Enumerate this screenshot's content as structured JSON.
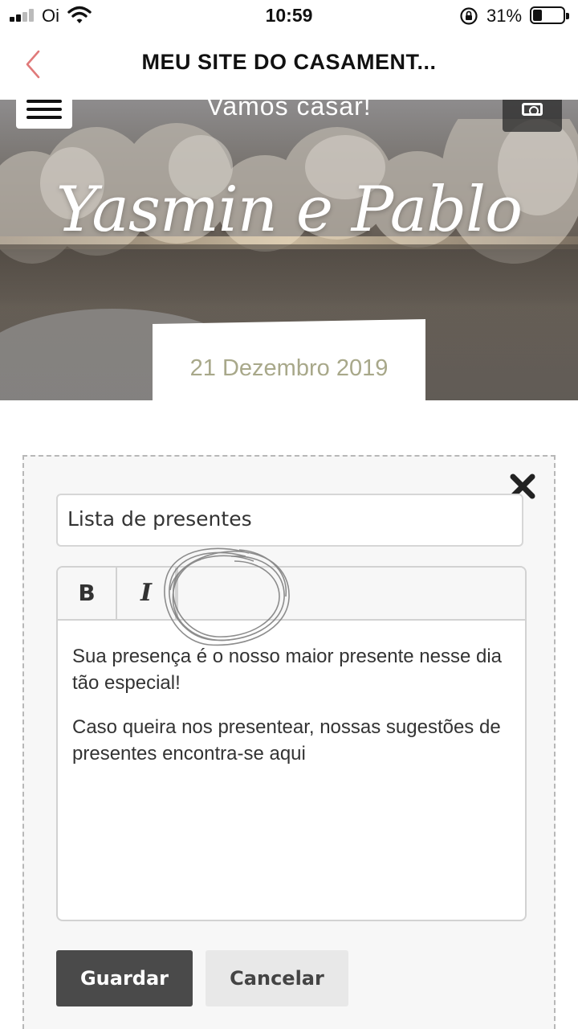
{
  "status_bar": {
    "carrier": "Oi",
    "time": "10:59",
    "battery_percent": "31%",
    "battery_level": 0.31,
    "icons": [
      "signal-icon",
      "wifi-icon",
      "orientation-lock-icon",
      "battery-icon"
    ]
  },
  "nav": {
    "title": "MEU SITE DO CASAMENT...",
    "back_icon": "chevron-left-icon",
    "accent_color": "#e07a7a"
  },
  "hero": {
    "subtitle": "Vamos casar!",
    "couple_names": "Yasmin e Pablo",
    "date": "21 Dezembro 2019",
    "menu_icon": "hamburger-menu-icon",
    "camera_icon": "camera-icon"
  },
  "editor": {
    "title_value": "Lista de presentes",
    "toolbar": {
      "bold_label": "B",
      "italic_label": "I"
    },
    "body_paragraphs": [
      "Sua presença é o nosso maior presente nesse dia tão especial!",
      "Caso queira nos presentear, nossas sugestões de presentes encontra-se aqui"
    ],
    "save_label": "Guardar",
    "cancel_label": "Cancelar",
    "close_icon": "close-icon"
  },
  "colors": {
    "date_text": "#a8a88a",
    "save_button": "#4a4a4a",
    "cancel_button": "#e8e8e8"
  }
}
